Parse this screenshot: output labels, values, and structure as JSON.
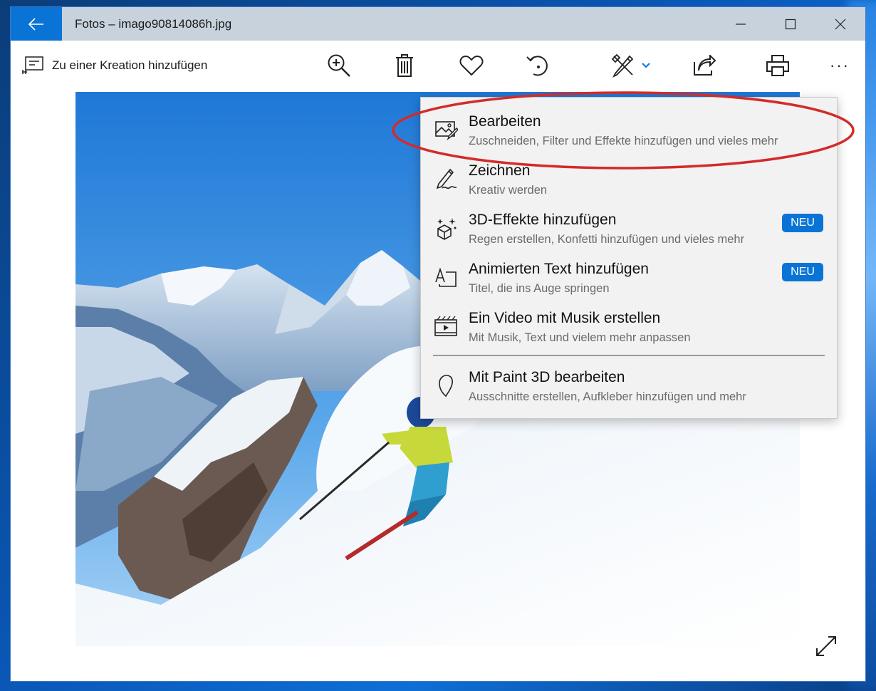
{
  "window": {
    "title": "Fotos – imago90814086h.jpg",
    "back_icon": "back-arrow-icon",
    "controls": [
      "minimize-icon",
      "maximize-icon",
      "close-icon"
    ]
  },
  "toolbar": {
    "add_to_creation_label": "Zu einer Kreation hinzufügen",
    "buttons": [
      "zoom-in-icon",
      "delete-icon",
      "favorite-icon",
      "rotate-icon",
      "edit-create-icon",
      "share-icon",
      "print-icon",
      "more-icon"
    ],
    "more_label": "···"
  },
  "menu": {
    "items": [
      {
        "title": "Bearbeiten",
        "subtitle": "Zuschneiden, Filter und Effekte hinzufügen und vieles mehr",
        "icon": "photo-edit-icon"
      },
      {
        "title": "Zeichnen",
        "subtitle": "Kreativ werden",
        "icon": "pen-draw-icon"
      },
      {
        "title": "3D-Effekte hinzufügen",
        "subtitle": "Regen erstellen, Konfetti hinzufügen und vieles mehr",
        "icon": "3d-effects-icon",
        "badge": "NEU"
      },
      {
        "title": "Animierten Text hinzufügen",
        "subtitle": "Titel, die ins Auge springen",
        "icon": "animated-text-icon",
        "badge": "NEU"
      },
      {
        "title": "Ein Video mit Musik erstellen",
        "subtitle": "Mit Musik, Text und vielem mehr anpassen",
        "icon": "video-music-icon"
      },
      {
        "title": "Mit Paint 3D bearbeiten",
        "subtitle": "Ausschnitte erstellen, Aufkleber hinzufügen und mehr",
        "icon": "paint3d-icon"
      }
    ]
  },
  "colors": {
    "accent": "#0a74d6",
    "highlight_ellipse": "#d42a2a",
    "titlebar": "#c8d2dd",
    "menu_bg": "#f2f2f2"
  }
}
